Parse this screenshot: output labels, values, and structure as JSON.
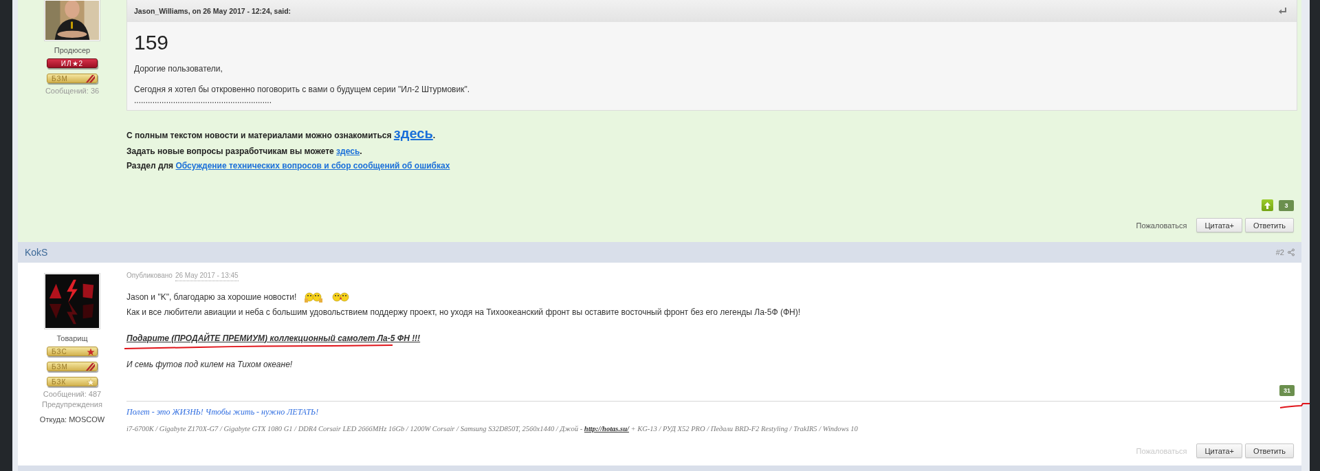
{
  "posts": [
    {
      "highlighted": true,
      "author": {
        "avatar": {
          "kind": "picture"
        },
        "rank": "Продюсер",
        "awards": [
          {
            "kind": "il2",
            "label": "ИЛ★2"
          },
          {
            "kind": "bzm",
            "label": "БЗМ"
          }
        ],
        "stats": [
          "Сообщений: 36"
        ]
      },
      "quote": {
        "citation": "Jason_Williams, on 26 May 2017 - 12:24, said:",
        "headline": "159",
        "paragraphs": [
          "Дорогие пользователи,",
          "Сегодня я хотел бы откровенно поговорить с вами о будущем серии \"Ил-2 Штурмовик\".",
          "............................................................"
        ]
      },
      "lines": [
        {
          "text": "С полным текстом новости и материалами можно ознакомиться ",
          "link": "здесь",
          "large_link": true,
          "after": "."
        },
        {
          "text": "Задать новые вопросы разработчикам вы можете ",
          "link": "здесь",
          "large_link": false,
          "after": "."
        },
        {
          "text": "Раздел для ",
          "link": "Обсуждение технических вопросов и сбор сообщений об ошибках",
          "large_link": false
        }
      ],
      "reputation": {
        "count": "3",
        "can_vote": true,
        "marked": false
      },
      "actions": {
        "report": "Пожаловаться",
        "report_disabled": false,
        "buttons": [
          "Цитата+",
          "Ответить"
        ]
      }
    },
    {
      "highlighted": false,
      "header": {
        "name": "KokS",
        "number": "#2"
      },
      "author": {
        "avatar": {
          "kind": "picture"
        },
        "rank": "Товарищ",
        "awards": [
          {
            "kind": "bzs",
            "label": "БЗС"
          },
          {
            "kind": "bzm",
            "label": "БЗМ"
          },
          {
            "kind": "bzk",
            "label": "БЗК"
          }
        ],
        "stats": [
          "Сообщений: 487",
          "Предупреждения"
        ],
        "location": "Откуда: MOSCOW"
      },
      "published": {
        "label": "Опубликовано",
        "date": "26 May 2017 - 13:45"
      },
      "body": [
        {
          "kind": "text",
          "text": "Jason и \"K\", благодарю за хорошие новости!",
          "smileys": [
            {
              "kind": "cheers"
            },
            {
              "kind": "kiss"
            }
          ],
          "marked": false
        },
        {
          "kind": "text",
          "text": "Как и все любители авиации и неба с большим удовольствием поддержу проект,  но уходя на Тихоокеанский фронт вы оставите восточный фронт без его легенды Ла-5Ф (ФН)!",
          "marked": false
        },
        {
          "kind": "emphasis",
          "text": "Подарите (ПРОДАЙТЕ ПРЕМИУМ) коллекционный самолет Ла-5 ФН !!!",
          "marked": true
        },
        {
          "kind": "italic",
          "text": "И семь футов под килем на Тихом океане!",
          "marked": false
        }
      ],
      "reputation": {
        "count": "31",
        "can_vote": false,
        "marked": true
      },
      "signature": {
        "motto": "Полет - это ЖИЗНЬ!  Чтобы жить - нужно ЛЕТАТЬ!",
        "specs_before": "i7-6700K / Gigabyte Z170X-G7 / Gigabyte GTX 1080 G1 / DDR4 Corsair LED 2666MHz 16Gb / 1200W Corsair / Samsung S32D850T, 2560x1440 / Джой - ",
        "specs_link": "http://hotas.su/",
        "specs_after": " + KG-13 / РУД X52 PRO  / Педали BRD-F2 Restyling / TrakIR5 / Windows 10"
      },
      "actions": {
        "report": "Пожаловаться",
        "report_disabled": true,
        "buttons": [
          "Цитата+",
          "Ответить"
        ]
      }
    }
  ]
}
